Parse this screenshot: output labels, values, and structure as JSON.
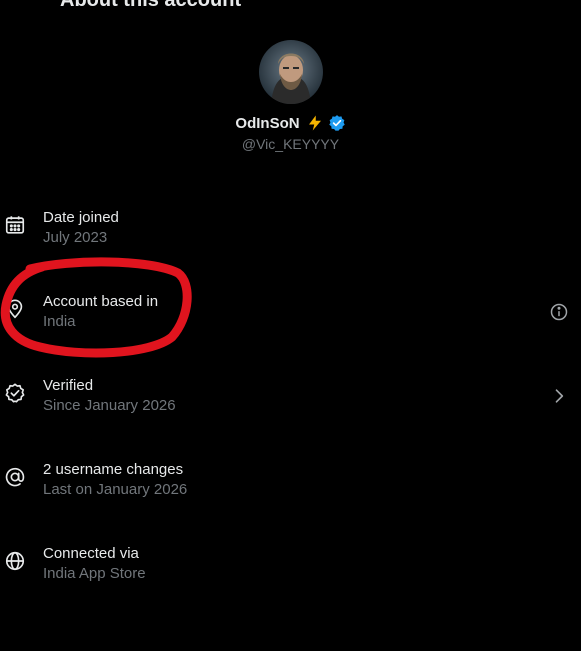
{
  "header": {
    "title": "About this account"
  },
  "profile": {
    "display_name": "OdInSoN",
    "handle": "@Vic_KEYYYY",
    "badge_icon": "lightning-bolt-icon",
    "verified_icon": "verified-badge-icon",
    "verified_color": "#1d9bf0"
  },
  "rows": [
    {
      "title": "Date joined",
      "subtitle": "July 2023",
      "icon": "calendar-icon",
      "trailing": ""
    },
    {
      "title": "Account based in",
      "subtitle": "India",
      "icon": "location-icon",
      "trailing": "info-icon"
    },
    {
      "title": "Verified",
      "subtitle": "Since January 2026",
      "icon": "verified-check-icon",
      "trailing": "chevron-right-icon"
    },
    {
      "title": "2 username changes",
      "subtitle": "Last on January 2026",
      "icon": "at-sign-icon",
      "trailing": ""
    },
    {
      "title": "Connected via",
      "subtitle": "India App Store",
      "icon": "globe-icon",
      "trailing": ""
    }
  ],
  "colors": {
    "background": "#000000",
    "primary_text": "#e7e9ea",
    "secondary_text": "#71767b",
    "annotation": "#e0141e",
    "bolt": "#f5b400"
  }
}
